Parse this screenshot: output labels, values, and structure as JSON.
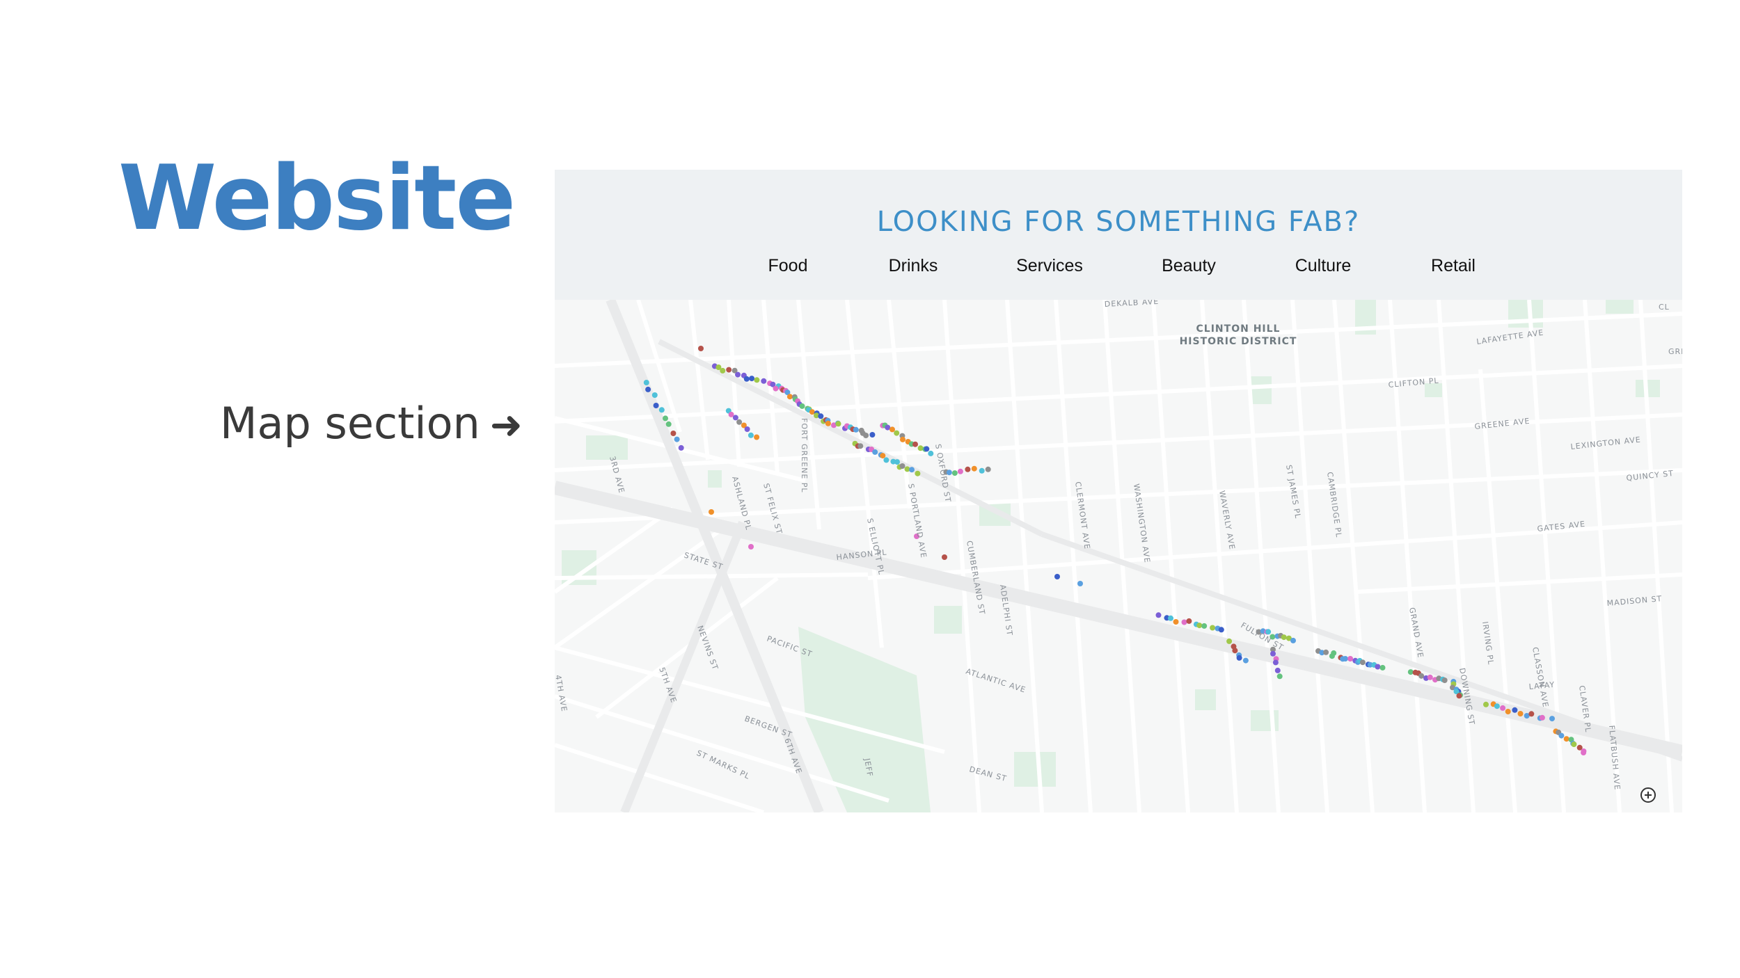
{
  "slide": {
    "title": "Website",
    "title_color": "#3d7fc1",
    "caption": "Map section",
    "caption_arrow": "➜"
  },
  "website": {
    "heading": "LOOKING FOR SOMETHING FAB?",
    "heading_color": "#3d8fc8",
    "nav": [
      "Food",
      "Drinks",
      "Services",
      "Beauty",
      "Culture",
      "Retail"
    ]
  },
  "map": {
    "district_label_line1": "CLINTON HILL",
    "district_label_line2": "HISTORIC DISTRICT",
    "street_labels": [
      "DEKALB AVE",
      "LAFAYETTE AVE",
      "CLIFTON PL",
      "GREENE AVE",
      "LEXINGTON AVE",
      "QUINCY ST",
      "GATES AVE",
      "MADISON ST",
      "FULTON ST",
      "ATLANTIC AVE",
      "HANSON PL",
      "STATE ST",
      "PACIFIC ST",
      "BERGEN ST",
      "ST MARKS PL",
      "DEAN ST",
      "FORT GREENE PL",
      "ASHLAND PL",
      "ST FELIX ST",
      "S ELLIOTT PL",
      "S PORTLAND AVE",
      "S OXFORD ST",
      "CUMBERLAND ST",
      "ADELPHI ST",
      "CLERMONT AVE",
      "WAVERLY AVE",
      "WASHINGTON AVE",
      "ST JAMES PL",
      "CAMBRIDGE PL",
      "GRAND AVE",
      "DOWNING ST",
      "IRVING PL",
      "CLASSON AVE",
      "CLAVER PL",
      "FLATBUSH AVE",
      "NEVINS ST",
      "3RD AVE",
      "4TH AVE",
      "5TH AVE",
      "6TH AVE",
      "JEFF",
      "LAFAY",
      "CL",
      "GREENE AV"
    ],
    "category_colors": [
      "#5aa0e0",
      "#7b5fd6",
      "#e06fc8",
      "#4fc1d9",
      "#8f8f8f",
      "#a0c84a",
      "#f0902a",
      "#b5524a",
      "#64c27f",
      "#3a5ec9"
    ],
    "zoom_icon": "zoom-in-icon"
  }
}
